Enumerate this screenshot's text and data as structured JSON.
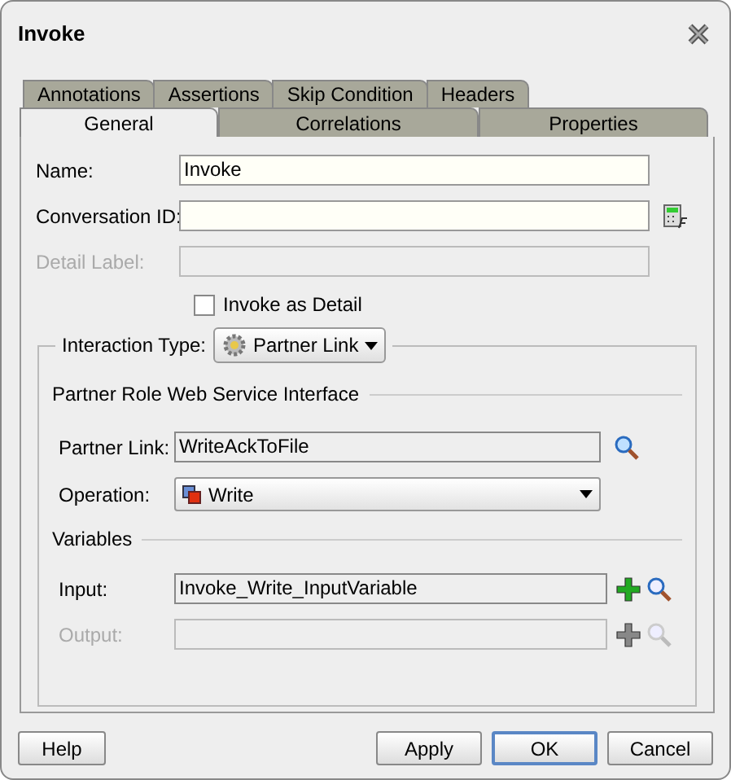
{
  "window": {
    "title": "Invoke"
  },
  "tab_rows": [
    [
      {
        "label": "Annotations",
        "selected": false
      },
      {
        "label": "Assertions",
        "selected": false
      },
      {
        "label": "Skip Condition",
        "selected": false
      },
      {
        "label": "Headers",
        "selected": false
      }
    ],
    [
      {
        "label": "General",
        "selected": true
      },
      {
        "label": "Correlations",
        "selected": false
      },
      {
        "label": "Properties",
        "selected": false
      }
    ]
  ],
  "fields": [
    {
      "kind": "plain",
      "label": "Name:",
      "value": "Invoke",
      "disabled": false
    },
    {
      "kind": "expression",
      "label": "Conversation ID:",
      "disabled": false
    },
    {
      "kind": "plain",
      "label": "Detail Label:",
      "disabled": true
    }
  ],
  "checkbox": {
    "label": "Invoke as Detail",
    "checked": false
  },
  "interaction_type": {
    "label": "Interaction Type:",
    "value": "Partner Link"
  },
  "partner_role": {
    "title": "Partner Role Web Service Interface",
    "partner_link": {
      "label": "Partner Link:",
      "value": "WriteAckToFile"
    },
    "operation": {
      "label": "Operation:",
      "value": "Write"
    }
  },
  "variables": {
    "title": "Variables",
    "items": [
      {
        "label": "Input:",
        "value": "Invoke_Write_InputVariable",
        "disabled": false
      },
      {
        "label": "Output:",
        "disabled": true
      }
    ]
  },
  "buttons": [
    {
      "label": "Help",
      "default": false
    },
    {
      "label": "Apply",
      "default": false
    },
    {
      "label": "OK",
      "default": true
    },
    {
      "label": "Cancel",
      "default": false
    }
  ]
}
